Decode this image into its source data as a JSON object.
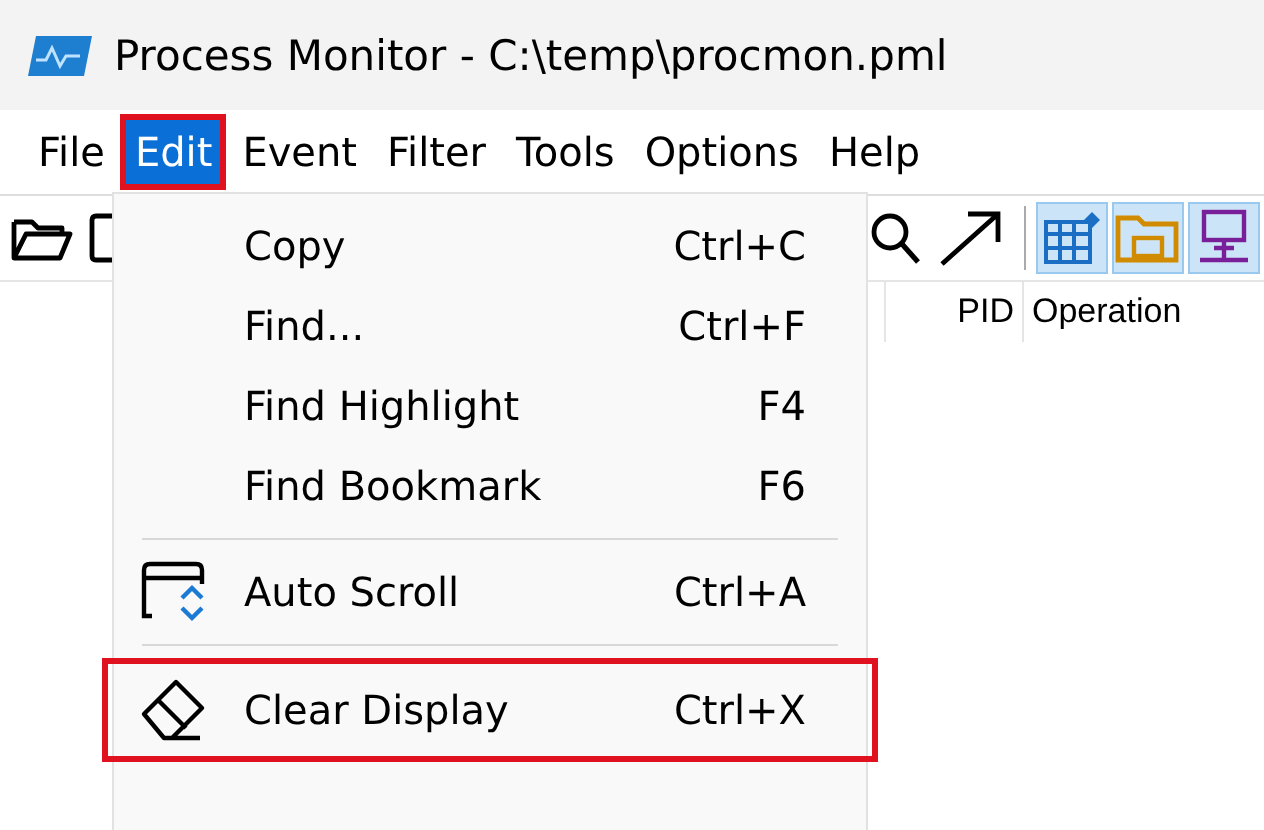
{
  "window": {
    "title": "Process Monitor - C:\\temp\\procmon.pml"
  },
  "menu_bar": [
    {
      "label": "File",
      "selected": false,
      "outlined": false
    },
    {
      "label": "Edit",
      "selected": true,
      "outlined": true
    },
    {
      "label": "Event",
      "selected": false,
      "outlined": false
    },
    {
      "label": "Filter",
      "selected": false,
      "outlined": false
    },
    {
      "label": "Tools",
      "selected": false,
      "outlined": false
    },
    {
      "label": "Options",
      "selected": false,
      "outlined": false
    },
    {
      "label": "Help",
      "selected": false,
      "outlined": false
    }
  ],
  "toolbar_left": [
    {
      "kind": "open"
    },
    {
      "kind": "save"
    }
  ],
  "toolbar_right": [
    {
      "kind": "find"
    },
    {
      "kind": "jump"
    },
    {
      "kind": "separator"
    },
    {
      "kind": "registry",
      "pressed": true
    },
    {
      "kind": "filesystem",
      "pressed": true
    },
    {
      "kind": "network",
      "pressed": true
    }
  ],
  "columns": [
    "PID",
    "Operation"
  ],
  "edit_menu": [
    {
      "kind": "text",
      "label": "Copy",
      "shortcut": "Ctrl+C",
      "outlined": false
    },
    {
      "kind": "text",
      "label": "Find...",
      "shortcut": "Ctrl+F",
      "outlined": false
    },
    {
      "kind": "text",
      "label": "Find Highlight",
      "shortcut": "F4",
      "outlined": false
    },
    {
      "kind": "text",
      "label": "Find Bookmark",
      "shortcut": "F6",
      "outlined": false
    },
    {
      "kind": "separator"
    },
    {
      "kind": "autoscroll",
      "label": "Auto Scroll",
      "shortcut": "Ctrl+A",
      "outlined": false
    },
    {
      "kind": "separator"
    },
    {
      "kind": "clear",
      "label": "Clear Display",
      "shortcut": "Ctrl+X",
      "outlined": true
    }
  ]
}
